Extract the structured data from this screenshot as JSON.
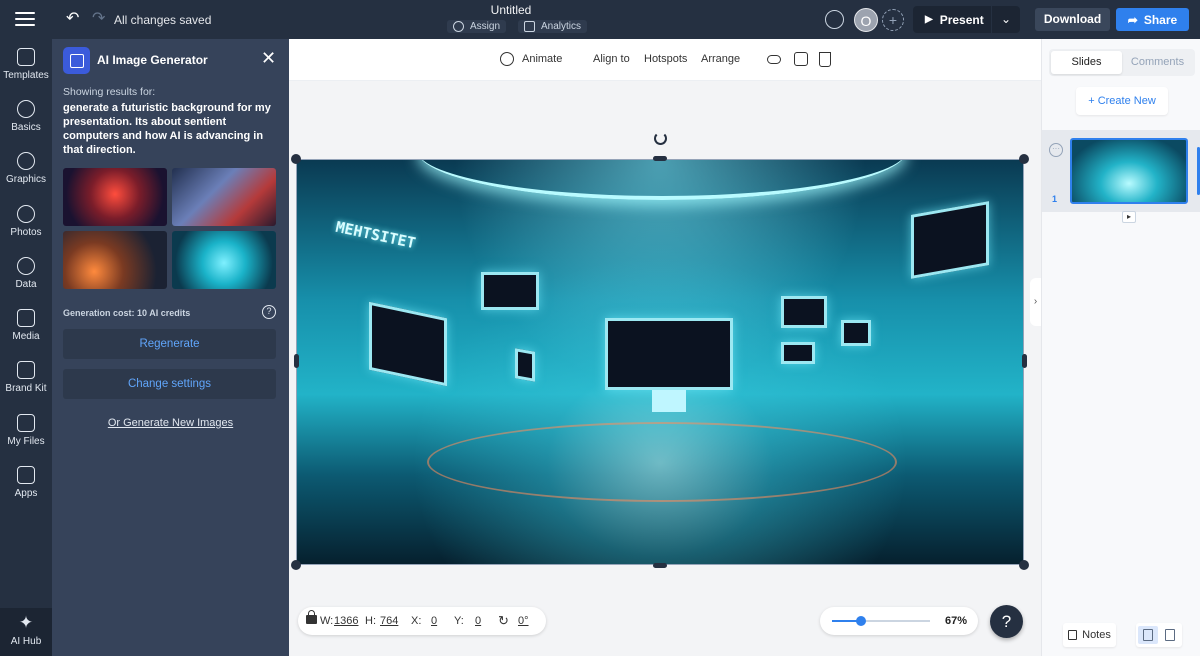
{
  "header": {
    "status": "All changes saved",
    "doc_title": "Untitled",
    "assign_label": "Assign",
    "analytics_label": "Analytics",
    "avatar_initial": "O",
    "present_label": "Present",
    "download_label": "Download",
    "share_label": "Share"
  },
  "rail": {
    "items": [
      {
        "label": "Templates",
        "icon": "templates-icon"
      },
      {
        "label": "Basics",
        "icon": "basics-icon"
      },
      {
        "label": "Graphics",
        "icon": "graphics-icon"
      },
      {
        "label": "Photos",
        "icon": "photos-icon"
      },
      {
        "label": "Data",
        "icon": "data-icon"
      },
      {
        "label": "Media",
        "icon": "media-icon"
      },
      {
        "label": "Brand Kit",
        "icon": "brand-kit-icon"
      },
      {
        "label": "My Files",
        "icon": "folder-icon"
      },
      {
        "label": "Apps",
        "icon": "apps-icon"
      },
      {
        "label": "AI Hub",
        "icon": "sparkle-icon"
      }
    ]
  },
  "generator": {
    "title": "AI Image Generator",
    "showing_label": "Showing results for:",
    "prompt": "generate a futuristic background for my presentation. Its about sentient computers and how AI is advancing in that direction.",
    "cost_label": "Generation cost: 10 AI credits",
    "regenerate_label": "Regenerate",
    "change_settings_label": "Change settings",
    "generate_new_label": "Or Generate New Images"
  },
  "toolbar": {
    "animate_label": "Animate",
    "align_label": "Align to",
    "hotspots_label": "Hotspots",
    "arrange_label": "Arrange"
  },
  "slide_image": {
    "wall_text": "MEHTSITET"
  },
  "dims": {
    "w_label": "W:",
    "w_value": "1366",
    "h_label": "H:",
    "h_value": "764",
    "x_label": "X:",
    "x_value": "0",
    "y_label": "Y:",
    "y_value": "0",
    "rotation_value": "0°"
  },
  "zoom": {
    "value_label": "67%",
    "level": 0.67
  },
  "help_label": "?",
  "right_panel": {
    "tab_slides": "Slides",
    "tab_comments": "Comments",
    "create_new_label": "+ Create New",
    "slide_number": "1",
    "notes_label": "Notes"
  },
  "colors": {
    "topbar": "#253041",
    "panel": "#36435a",
    "accent": "#2f80ed"
  }
}
